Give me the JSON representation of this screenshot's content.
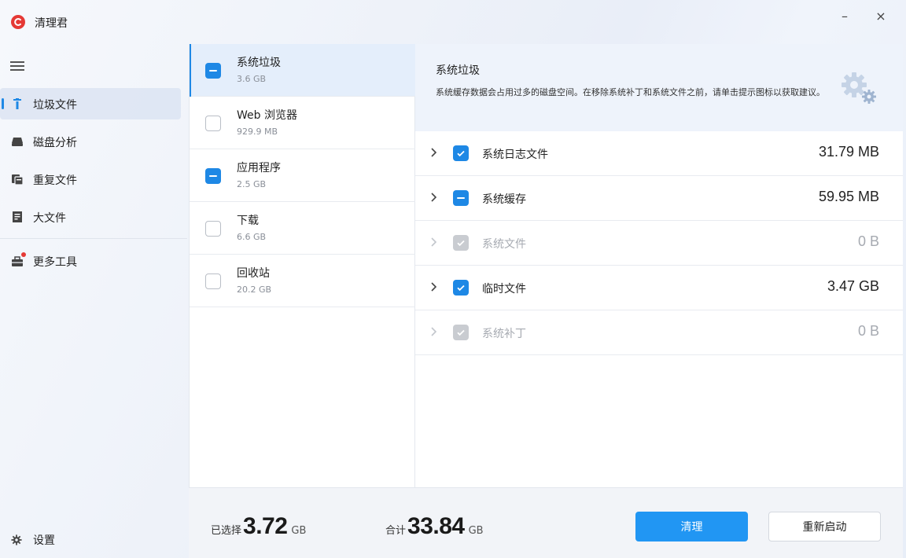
{
  "app": {
    "title": "清理君"
  },
  "window": {
    "minimize": "–",
    "close": "×"
  },
  "sidebar": {
    "items": [
      {
        "label": "垃圾文件",
        "icon": "trash-icon",
        "active": true
      },
      {
        "label": "磁盘分析",
        "icon": "disk-icon"
      },
      {
        "label": "重复文件",
        "icon": "duplicate-icon"
      },
      {
        "label": "大文件",
        "icon": "large-file-icon"
      },
      {
        "label": "更多工具",
        "icon": "toolbox-icon",
        "badge": true
      }
    ],
    "settings_label": "设置"
  },
  "categories": [
    {
      "name": "系统垃圾",
      "size": "3.6 GB",
      "state": "partial",
      "active": true
    },
    {
      "name": "Web 浏览器",
      "size": "929.9 MB",
      "state": "unchecked"
    },
    {
      "name": "应用程序",
      "size": "2.5 GB",
      "state": "partial"
    },
    {
      "name": "下载",
      "size": "6.6 GB",
      "state": "unchecked"
    },
    {
      "name": "回收站",
      "size": "20.2 GB",
      "state": "unchecked"
    }
  ],
  "detail": {
    "title": "系统垃圾",
    "description": "系统缓存数据会占用过多的磁盘空间。在移除系统补丁和系统文件之前，请单击提示图标以获取建议。",
    "tip_icon": "gears-icon",
    "files": [
      {
        "name": "系统日志文件",
        "size": "31.79 MB",
        "state": "checked"
      },
      {
        "name": "系统缓存",
        "size": "59.95 MB",
        "state": "partial"
      },
      {
        "name": "系统文件",
        "size": "0 B",
        "state": "disabled"
      },
      {
        "name": "临时文件",
        "size": "3.47 GB",
        "state": "checked"
      },
      {
        "name": "系统补丁",
        "size": "0 B",
        "state": "disabled"
      }
    ]
  },
  "footer": {
    "selected_label": "已选择",
    "selected_value": "3.72",
    "selected_unit": "GB",
    "total_label": "合计",
    "total_value": "33.84",
    "total_unit": "GB",
    "clean_button": "清理",
    "restart_button": "重新启动"
  },
  "colors": {
    "accent": "#2196f3",
    "brand": "#e53935",
    "selected_row": "#e4eefb"
  }
}
